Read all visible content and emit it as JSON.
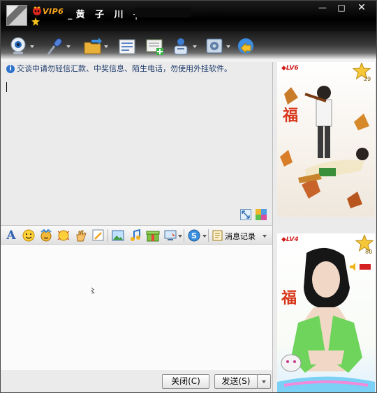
{
  "title_bar": {
    "vip_label": "VIP6",
    "nickname": "_黄 子 川 ╮",
    "minimize": "—",
    "maximize": "□",
    "close": "✕"
  },
  "toolbar": {
    "icons": [
      "webcam-icon",
      "microphone-icon",
      "transfer-file-icon",
      "send-email-icon",
      "send-sms-icon",
      "create-group-icon",
      "app-settings-icon",
      "remote-assist-icon"
    ]
  },
  "message_area": {
    "warning": "交谈中请勿轻信汇款、中奖信息、陌生电话，勿使用外挂软件。"
  },
  "input_toolbar": {
    "font_icon": "A",
    "history_label": "消息记录"
  },
  "input_area": {
    "cursor_glyph": "〻"
  },
  "bottom": {
    "close_button": "关闭(C)",
    "send_button": "发送(S)"
  },
  "right_panel": {
    "friend_show": {
      "level": "LV6",
      "stars": "29"
    },
    "my_show": {
      "level": "LV4",
      "stars": "80"
    }
  },
  "colors": {
    "vip": "#f7a21b",
    "link": "#1e3b6b",
    "accent_blue": "#2d73cc"
  }
}
